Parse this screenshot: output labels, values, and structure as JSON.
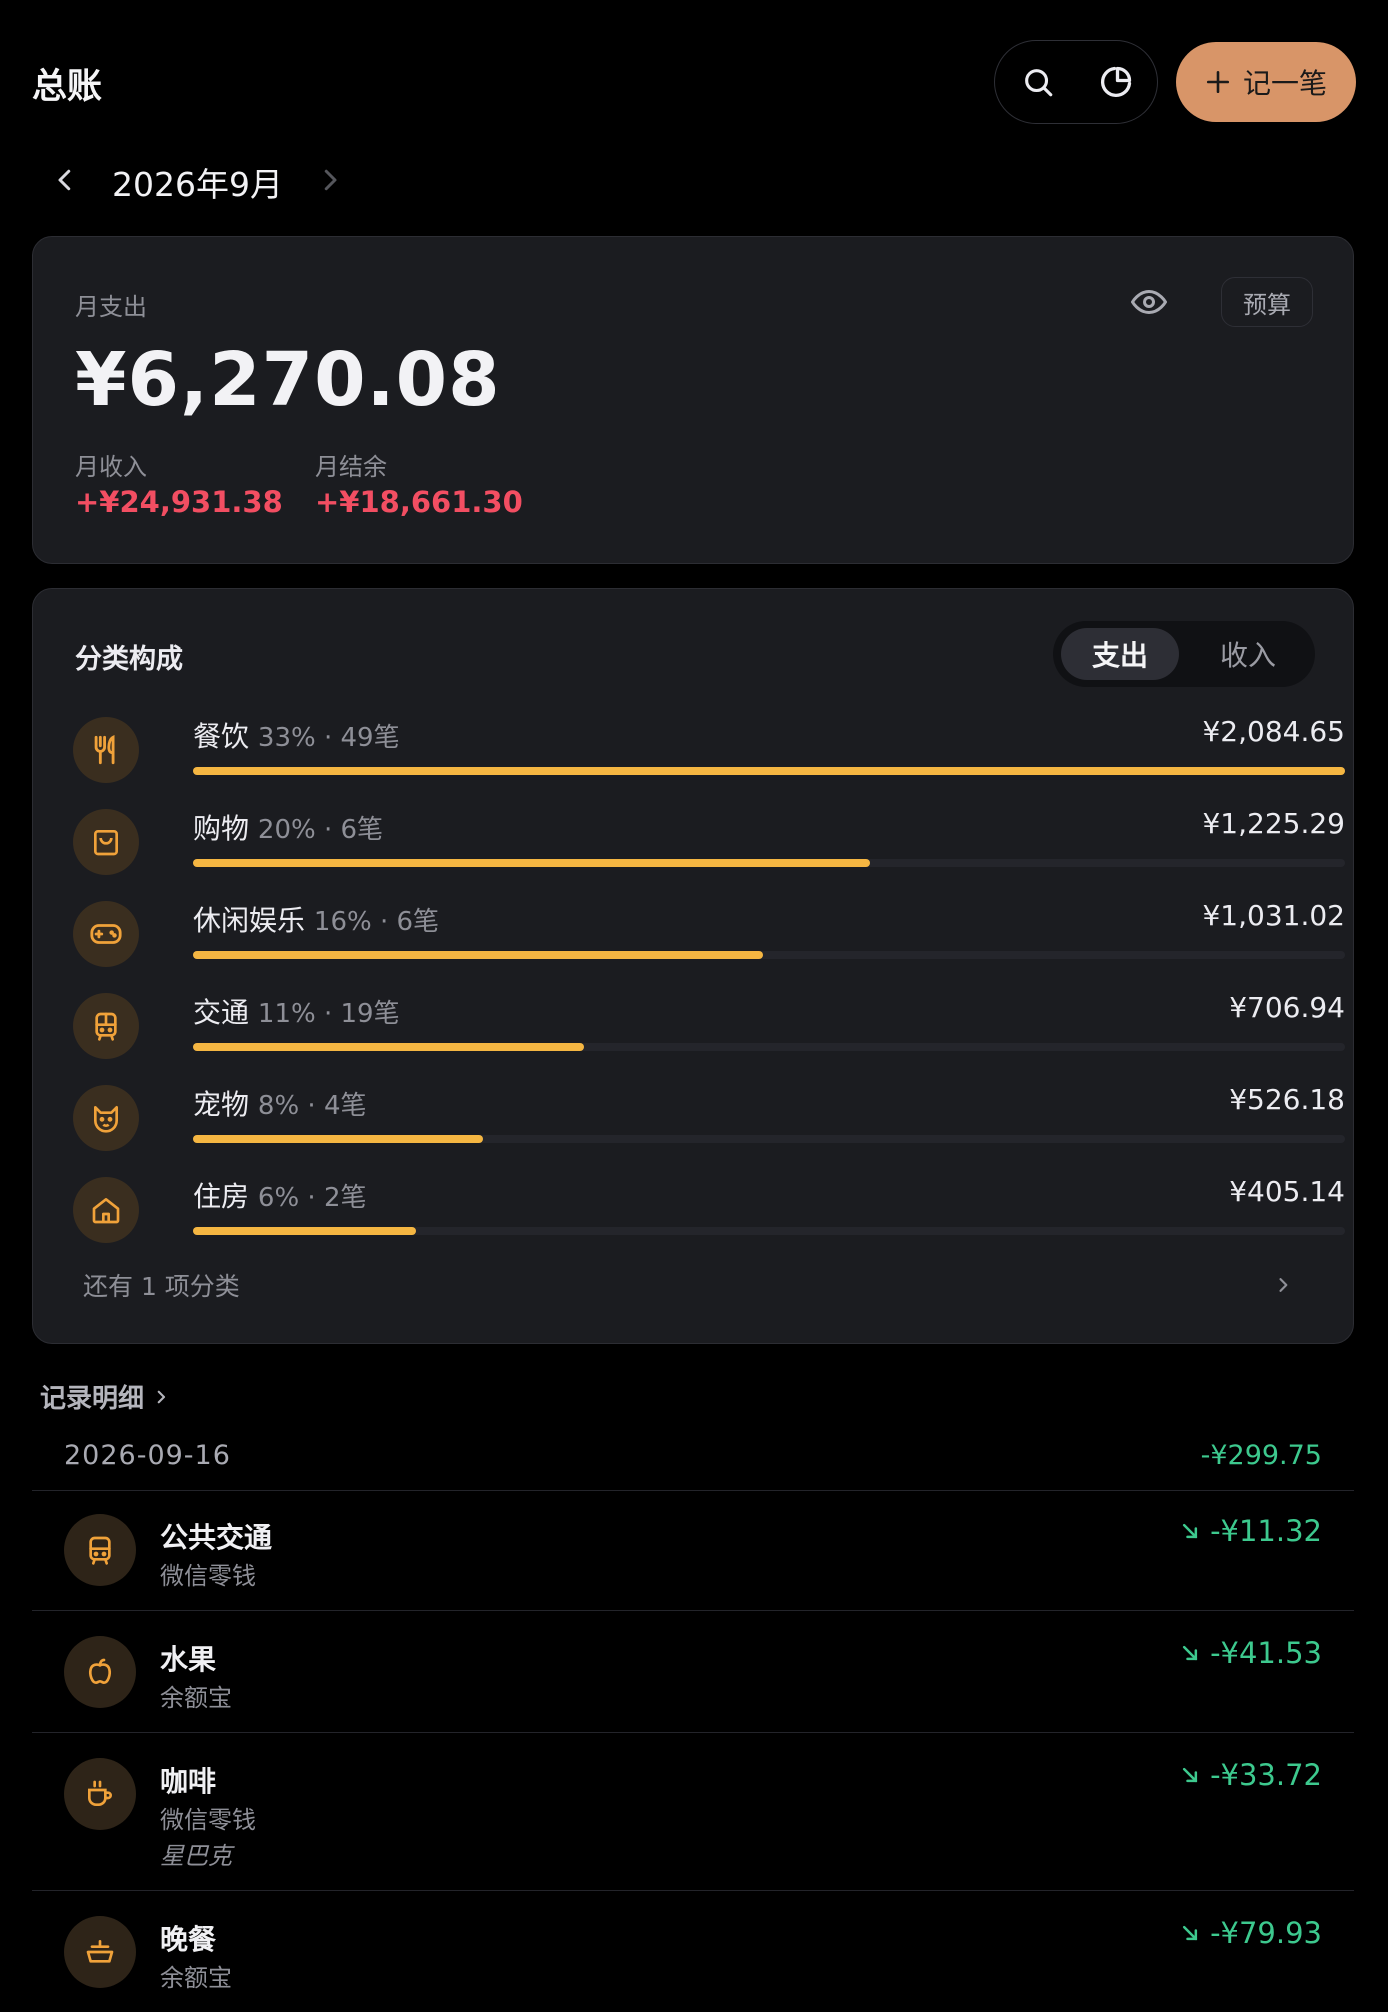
{
  "header": {
    "title": "总账",
    "add_label": "记一笔",
    "icons": {
      "search": "search-icon",
      "stats": "pie-chart-icon",
      "add": "plus-icon"
    }
  },
  "month_nav": {
    "label": "2026年9月"
  },
  "summary": {
    "expense_label": "月支出",
    "expense_amount": "¥6,270.08",
    "income_label": "月收入",
    "income_amount": "+¥24,931.38",
    "balance_label": "月结余",
    "balance_amount": "+¥18,661.30",
    "budget_label": "预算"
  },
  "category": {
    "title": "分类构成",
    "tabs": {
      "expense": "支出",
      "income": "收入",
      "active": "expense"
    },
    "items": [
      {
        "name": "餐饮",
        "meta": "33% · 49笔",
        "amount": "¥2,084.65",
        "share": 1.0,
        "icon": "utensils-icon"
      },
      {
        "name": "购物",
        "meta": "20% · 6笔",
        "amount": "¥1,225.29",
        "share": 0.588,
        "icon": "shopping-bag-icon"
      },
      {
        "name": "休闲娱乐",
        "meta": "16% · 6笔",
        "amount": "¥1,031.02",
        "share": 0.495,
        "icon": "gamepad-icon"
      },
      {
        "name": "交通",
        "meta": "11% · 19笔",
        "amount": "¥706.94",
        "share": 0.339,
        "icon": "bus-icon"
      },
      {
        "name": "宠物",
        "meta": "8% · 4笔",
        "amount": "¥526.18",
        "share": 0.252,
        "icon": "cat-icon"
      },
      {
        "name": "住房",
        "meta": "6% · 2笔",
        "amount": "¥405.14",
        "share": 0.194,
        "icon": "house-icon"
      }
    ],
    "more_label": "还有 1 项分类"
  },
  "records": {
    "title": "记录明细",
    "date": "2026-09-16",
    "date_total": "-¥299.75",
    "items": [
      {
        "name": "公共交通",
        "account": "微信零钱",
        "note": "",
        "amount": "-¥11.32",
        "icon": "bus-icon"
      },
      {
        "name": "水果",
        "account": "余额宝",
        "note": "",
        "amount": "-¥41.53",
        "icon": "apple-icon"
      },
      {
        "name": "咖啡",
        "account": "微信零钱",
        "note": "星巴克",
        "amount": "-¥33.72",
        "icon": "coffee-icon"
      },
      {
        "name": "晚餐",
        "account": "余额宝",
        "note": "",
        "amount": "-¥79.93",
        "icon": "bowl-icon"
      }
    ]
  },
  "colors": {
    "accent": "#D89568",
    "bar": "#F5B642",
    "income": "#F24E62",
    "expense": "#3DC98E",
    "icon": "#F0A23A"
  }
}
